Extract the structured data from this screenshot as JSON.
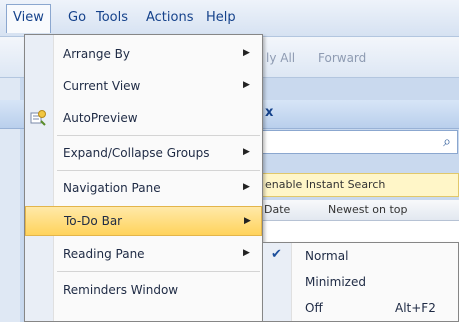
{
  "menubar": {
    "items": [
      {
        "label": "View"
      },
      {
        "label": "Go"
      },
      {
        "label": "Tools"
      },
      {
        "label": "Actions"
      },
      {
        "label": "Help"
      }
    ]
  },
  "toolbar": {
    "reply_all": "ly All",
    "forward": "Forward"
  },
  "background": {
    "pane_close": "x",
    "banner": "enable Instant Search",
    "col_date": "Date",
    "col_sort": "Newest on top"
  },
  "view_menu": {
    "items": [
      {
        "label": "Arrange By",
        "submenu": true
      },
      {
        "label": "Current View",
        "submenu": true
      },
      {
        "label": "AutoPreview",
        "submenu": false,
        "icon": "autopreview-icon"
      },
      {
        "label": "Expand/Collapse Groups",
        "submenu": true
      },
      {
        "label": "Navigation Pane",
        "submenu": true
      },
      {
        "label": "To-Do Bar",
        "submenu": true,
        "highlighted": true
      },
      {
        "label": "Reading Pane",
        "submenu": true
      },
      {
        "label": "Reminders Window",
        "submenu": false
      }
    ]
  },
  "todo_submenu": {
    "items": [
      {
        "label": "Normal",
        "checked": true,
        "shortcut": ""
      },
      {
        "label": "Minimized",
        "checked": false,
        "shortcut": ""
      },
      {
        "label": "Off",
        "checked": false,
        "shortcut": "Alt+F2"
      }
    ],
    "check_glyph": "✔"
  },
  "colors": {
    "highlight": "#ffd35c",
    "accent": "#15428b"
  }
}
